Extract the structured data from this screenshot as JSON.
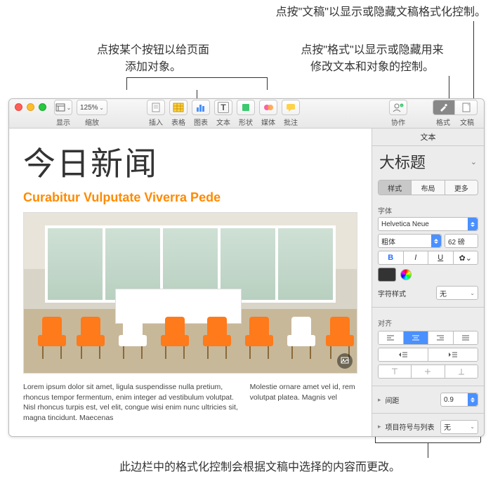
{
  "callouts": {
    "top_right": "点按\"文稿\"以显示或隐藏文稿格式化控制。",
    "mid_left_1": "点按某个按钮以给页面",
    "mid_left_2": "添加对象。",
    "mid_right_1": "点按\"格式\"以显示或隐藏用来",
    "mid_right_2": "修改文本和对象的控制。",
    "bottom": "此边栏中的格式化控制会根据文稿中选择的内容而更改。"
  },
  "toolbar": {
    "view_label": "显示",
    "zoom_value": "125%",
    "zoom_label": "缩放",
    "insert": "插入",
    "table": "表格",
    "chart": "图表",
    "text": "文本",
    "shape": "形状",
    "media": "媒体",
    "comment": "批注",
    "collab": "协作",
    "format": "格式",
    "document": "文稿"
  },
  "doc": {
    "title": "今日新闻",
    "subtitle": "Curabitur Vulputate Viverra Pede",
    "body_main": "Lorem ipsum dolor sit amet, ligula suspendisse nulla pretium, rhoncus tempor fermentum, enim integer ad vestibulum volutpat. Nisl rhoncus turpis est, vel elit, congue wisi enim nunc ultricies sit, magna tincidunt. Maecenas",
    "body_side": "Molestie ornare amet vel id, rem volutpat platea. Magnis vel"
  },
  "inspector": {
    "tab": "文本",
    "style_name": "大标题",
    "seg_style": "样式",
    "seg_layout": "布局",
    "seg_more": "更多",
    "font_label": "字体",
    "font_family": "Helvetica Neue",
    "font_weight": "粗体",
    "font_size": "62 磅",
    "b": "B",
    "i": "I",
    "u": "U",
    "char_style_label": "字符样式",
    "char_style_value": "无",
    "align_label": "对齐",
    "spacing_label": "间距",
    "spacing_value": "0.9",
    "bullets_label": "项目符号与列表",
    "bullets_value": "无"
  }
}
